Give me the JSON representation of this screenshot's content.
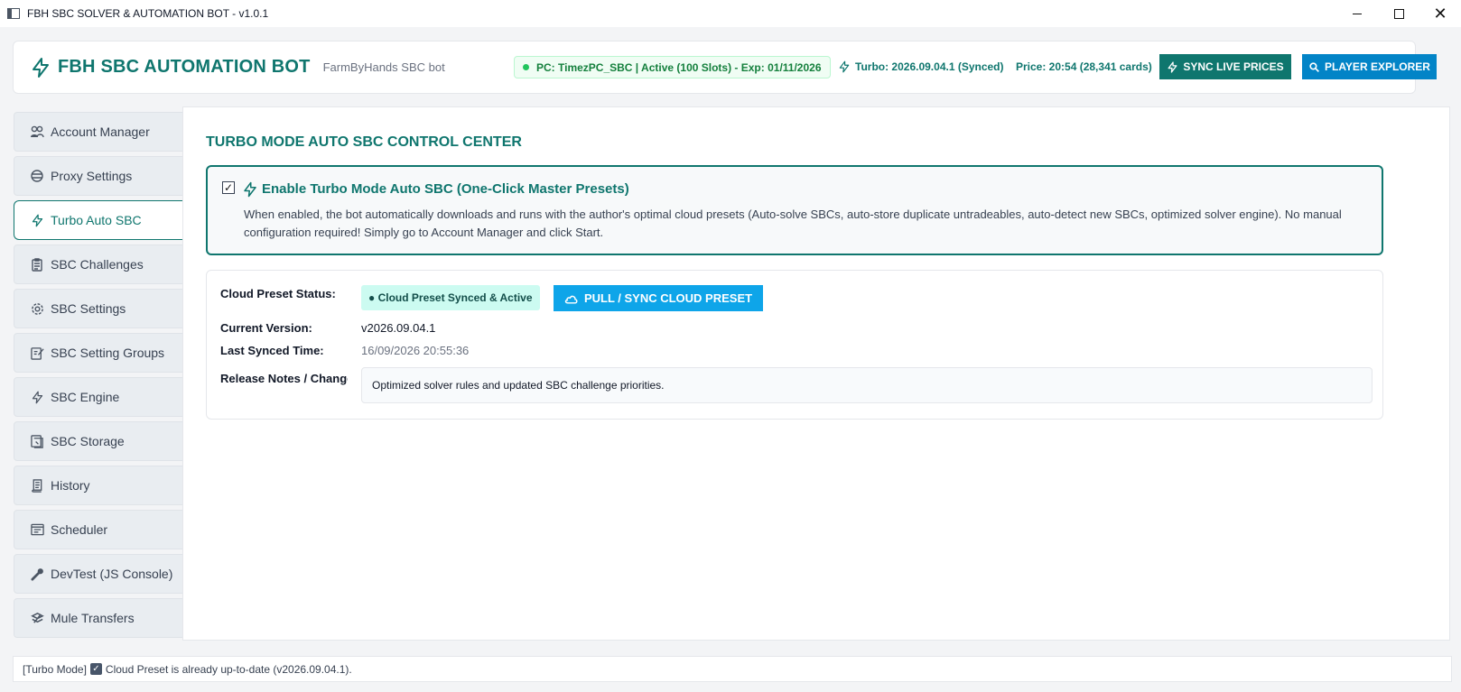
{
  "window": {
    "title": "FBH SBC SOLVER & AUTOMATION BOT - v1.0.1"
  },
  "header": {
    "title": "FBH SBC AUTOMATION BOT",
    "subtitle": "FarmByHands SBC bot",
    "pc_status": "PC: TimezPC_SBC | Active (100 Slots) - Exp: 01/11/2026",
    "turbo_version": "Turbo: 2026.09.04.1 (Synced)",
    "price_info": "Price: 20:54 (28,341 cards)",
    "sync_prices_label": "SYNC LIVE PRICES",
    "player_explorer_label": "PLAYER EXPLORER"
  },
  "sidebar": {
    "items": [
      {
        "label": "Account Manager",
        "icon": "users-icon"
      },
      {
        "label": "Proxy Settings",
        "icon": "globe-icon"
      },
      {
        "label": "Turbo Auto SBC",
        "icon": "bolt-icon",
        "active": true
      },
      {
        "label": "SBC Challenges",
        "icon": "clipboard-icon"
      },
      {
        "label": "SBC Settings",
        "icon": "gear-icon"
      },
      {
        "label": "SBC Setting Groups",
        "icon": "edit-icon"
      },
      {
        "label": "SBC Engine",
        "icon": "bolt-icon"
      },
      {
        "label": "SBC Storage",
        "icon": "storage-icon"
      },
      {
        "label": "History",
        "icon": "scroll-icon"
      },
      {
        "label": "Scheduler",
        "icon": "calendar-icon"
      },
      {
        "label": "DevTest (JS Console)",
        "icon": "wrench-icon"
      },
      {
        "label": "Mule Transfers",
        "icon": "transfer-icon"
      }
    ]
  },
  "main": {
    "section_title": "TURBO MODE AUTO SBC CONTROL CENTER",
    "turbo": {
      "checked": true,
      "label": "Enable Turbo Mode Auto SBC (One-Click Master Presets)",
      "description": "When enabled, the bot automatically downloads and runs with the author's optimal cloud presets (Auto-solve SBCs, auto-store duplicate untradeables, auto-detect new SBCs, optimized solver engine). No manual configuration required! Simply go to Account Manager and click Start."
    },
    "preset": {
      "status_label": "Cloud Preset Status:",
      "status_value": "● Cloud Preset Synced & Active",
      "pull_button": "PULL / SYNC CLOUD PRESET",
      "version_label": "Current Version:",
      "version_value": "v2026.09.04.1",
      "synced_label": "Last Synced Time:",
      "synced_value": "16/09/2026 20:55:36",
      "notes_label": "Release Notes / Changelog:",
      "notes_value": "Optimized solver rules and updated SBC challenge priorities."
    }
  },
  "statusbar": {
    "prefix": "[Turbo Mode]",
    "message": "Cloud Preset is already up-to-date (v2026.09.04.1)."
  },
  "colors": {
    "accent": "#0f766e",
    "blue": "#0284c7",
    "sky": "#0ea5e9",
    "success": "#15803d"
  }
}
